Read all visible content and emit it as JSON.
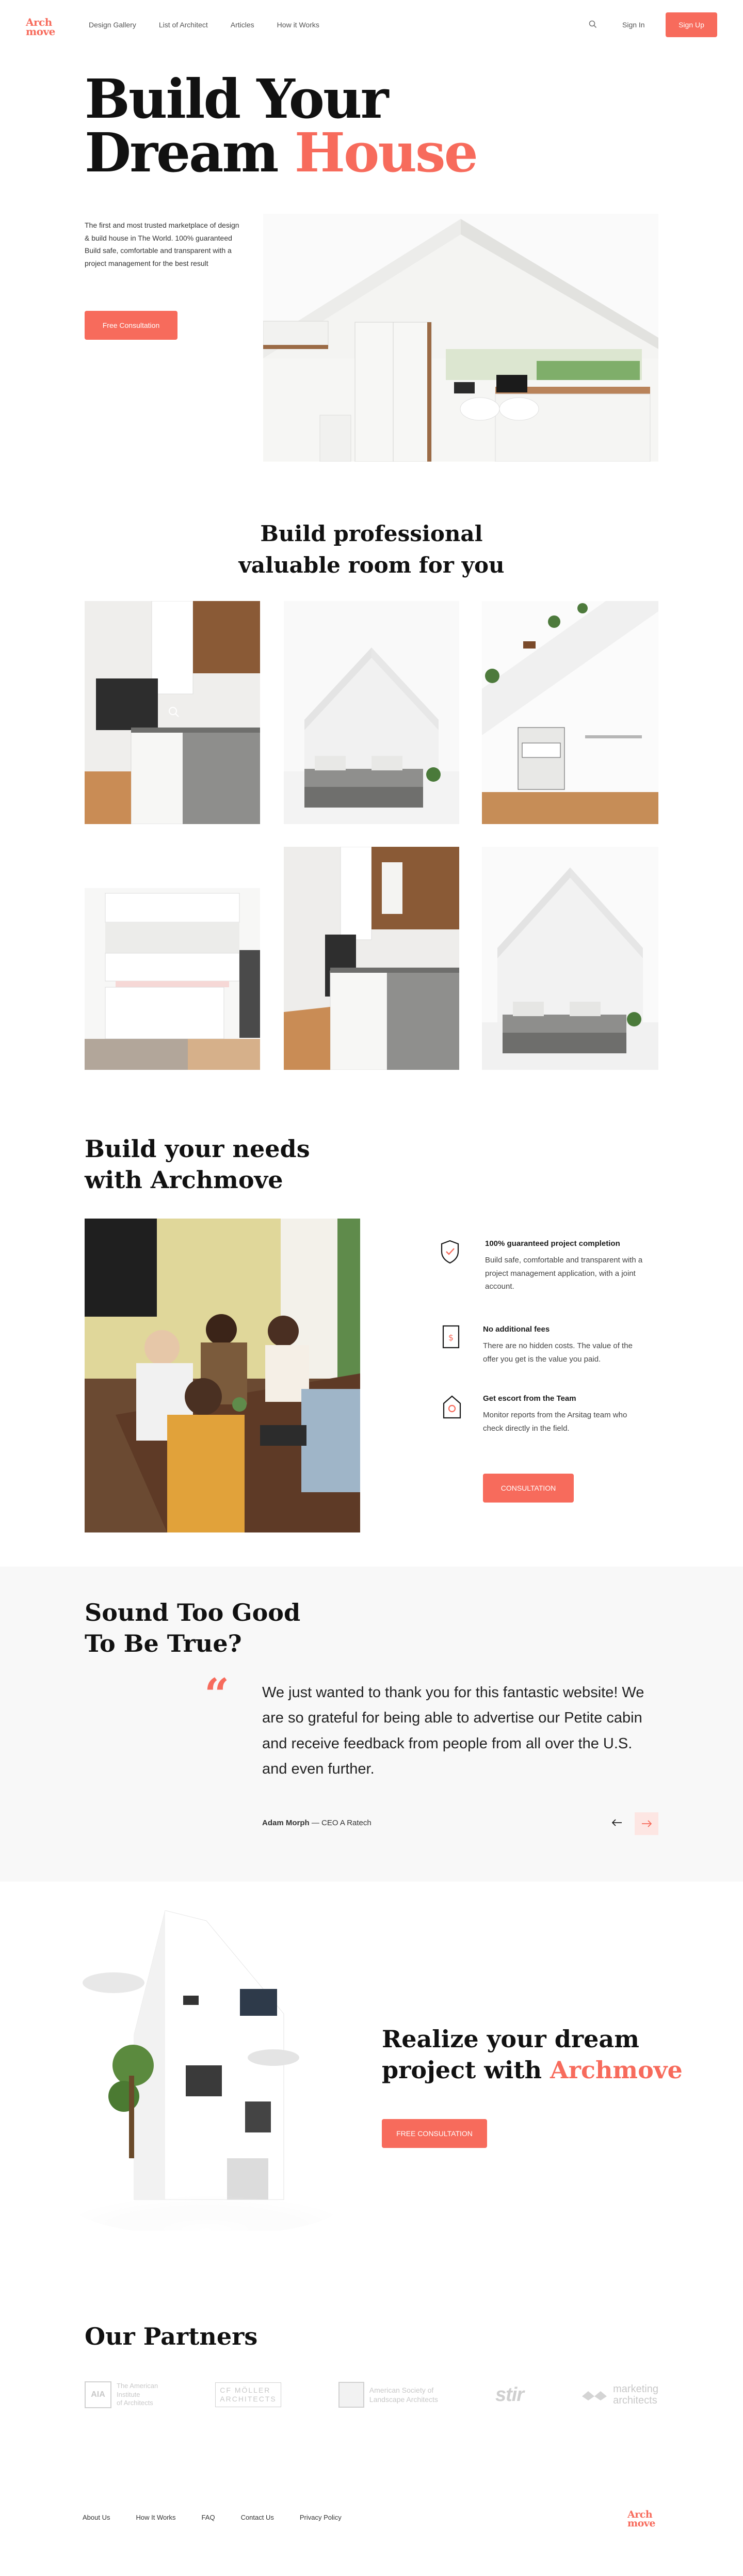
{
  "brand": {
    "logo_line1": "Arch",
    "logo_line2": "move",
    "accent": "#f76b5c"
  },
  "nav": {
    "links": [
      "Design Gallery",
      "List of Architect",
      "Articles",
      "How it Works"
    ],
    "sign_in": "Sign In",
    "sign_up": "Sign Up",
    "search_icon": "search-icon"
  },
  "hero": {
    "title_line1": "Build Your",
    "title_line2_plain": "Dream ",
    "title_line2_accent": "House",
    "description": "The first and most trusted marketplace of design & build house in The World. 100% guaranteed Build safe, comfortable and transparent with a project management for the best result",
    "cta": "Free Consultation"
  },
  "rooms": {
    "title_line1": "Build professional",
    "title_line2": "valuable room for you"
  },
  "needs": {
    "title_line1": "Build your needs",
    "title_line2": "with Archmove",
    "features": [
      {
        "icon": "shield-icon",
        "title": "100% guaranteed project completion",
        "text": "Build safe, comfortable and transparent with a project management application, with a joint account."
      },
      {
        "icon": "invoice-icon",
        "title": "No additional fees",
        "text": "There are no hidden costs. The value of the offer you get is the value you paid."
      },
      {
        "icon": "house-icon",
        "title": "Get escort from the Team",
        "text": "Monitor reports from the Arsitag team who check directly in the field."
      }
    ],
    "cta": "CONSULTATION"
  },
  "testimonial": {
    "title_line1": "Sound Too Good",
    "title_line2": "To Be True?",
    "quote": "We just wanted to thank you for this fantastic website! We are so grateful for being able to advertise our Petite cabin and receive feedback from people from all over the U.S. and even further.",
    "author": "Adam Morph",
    "author_role": " — CEO A Ratech",
    "prev_icon": "arrow-left-icon",
    "next_icon": "arrow-right-icon"
  },
  "realize": {
    "title_line1": "Realize your dream",
    "title_line2_plain": "project with ",
    "title_line2_accent": "Archmove",
    "cta": "FREE CONSULTATION"
  },
  "partners": {
    "title": "Our Partners",
    "items": [
      {
        "line1": "The American",
        "line2": "Institute",
        "line3": "of Architects"
      },
      {
        "line1": "CF MÖLLER",
        "line2": "ARCHITECTS",
        "line3": ""
      },
      {
        "line1": "American Society of",
        "line2": "Landscape Architects",
        "line3": ""
      },
      {
        "line1": "stir",
        "line2": "",
        "line3": ""
      },
      {
        "line1": "marketing",
        "line2": "architects",
        "line3": ""
      }
    ]
  },
  "footer": {
    "links": [
      "About Us",
      "How It Works",
      "FAQ",
      "Contact Us",
      "Privacy Policy"
    ]
  }
}
